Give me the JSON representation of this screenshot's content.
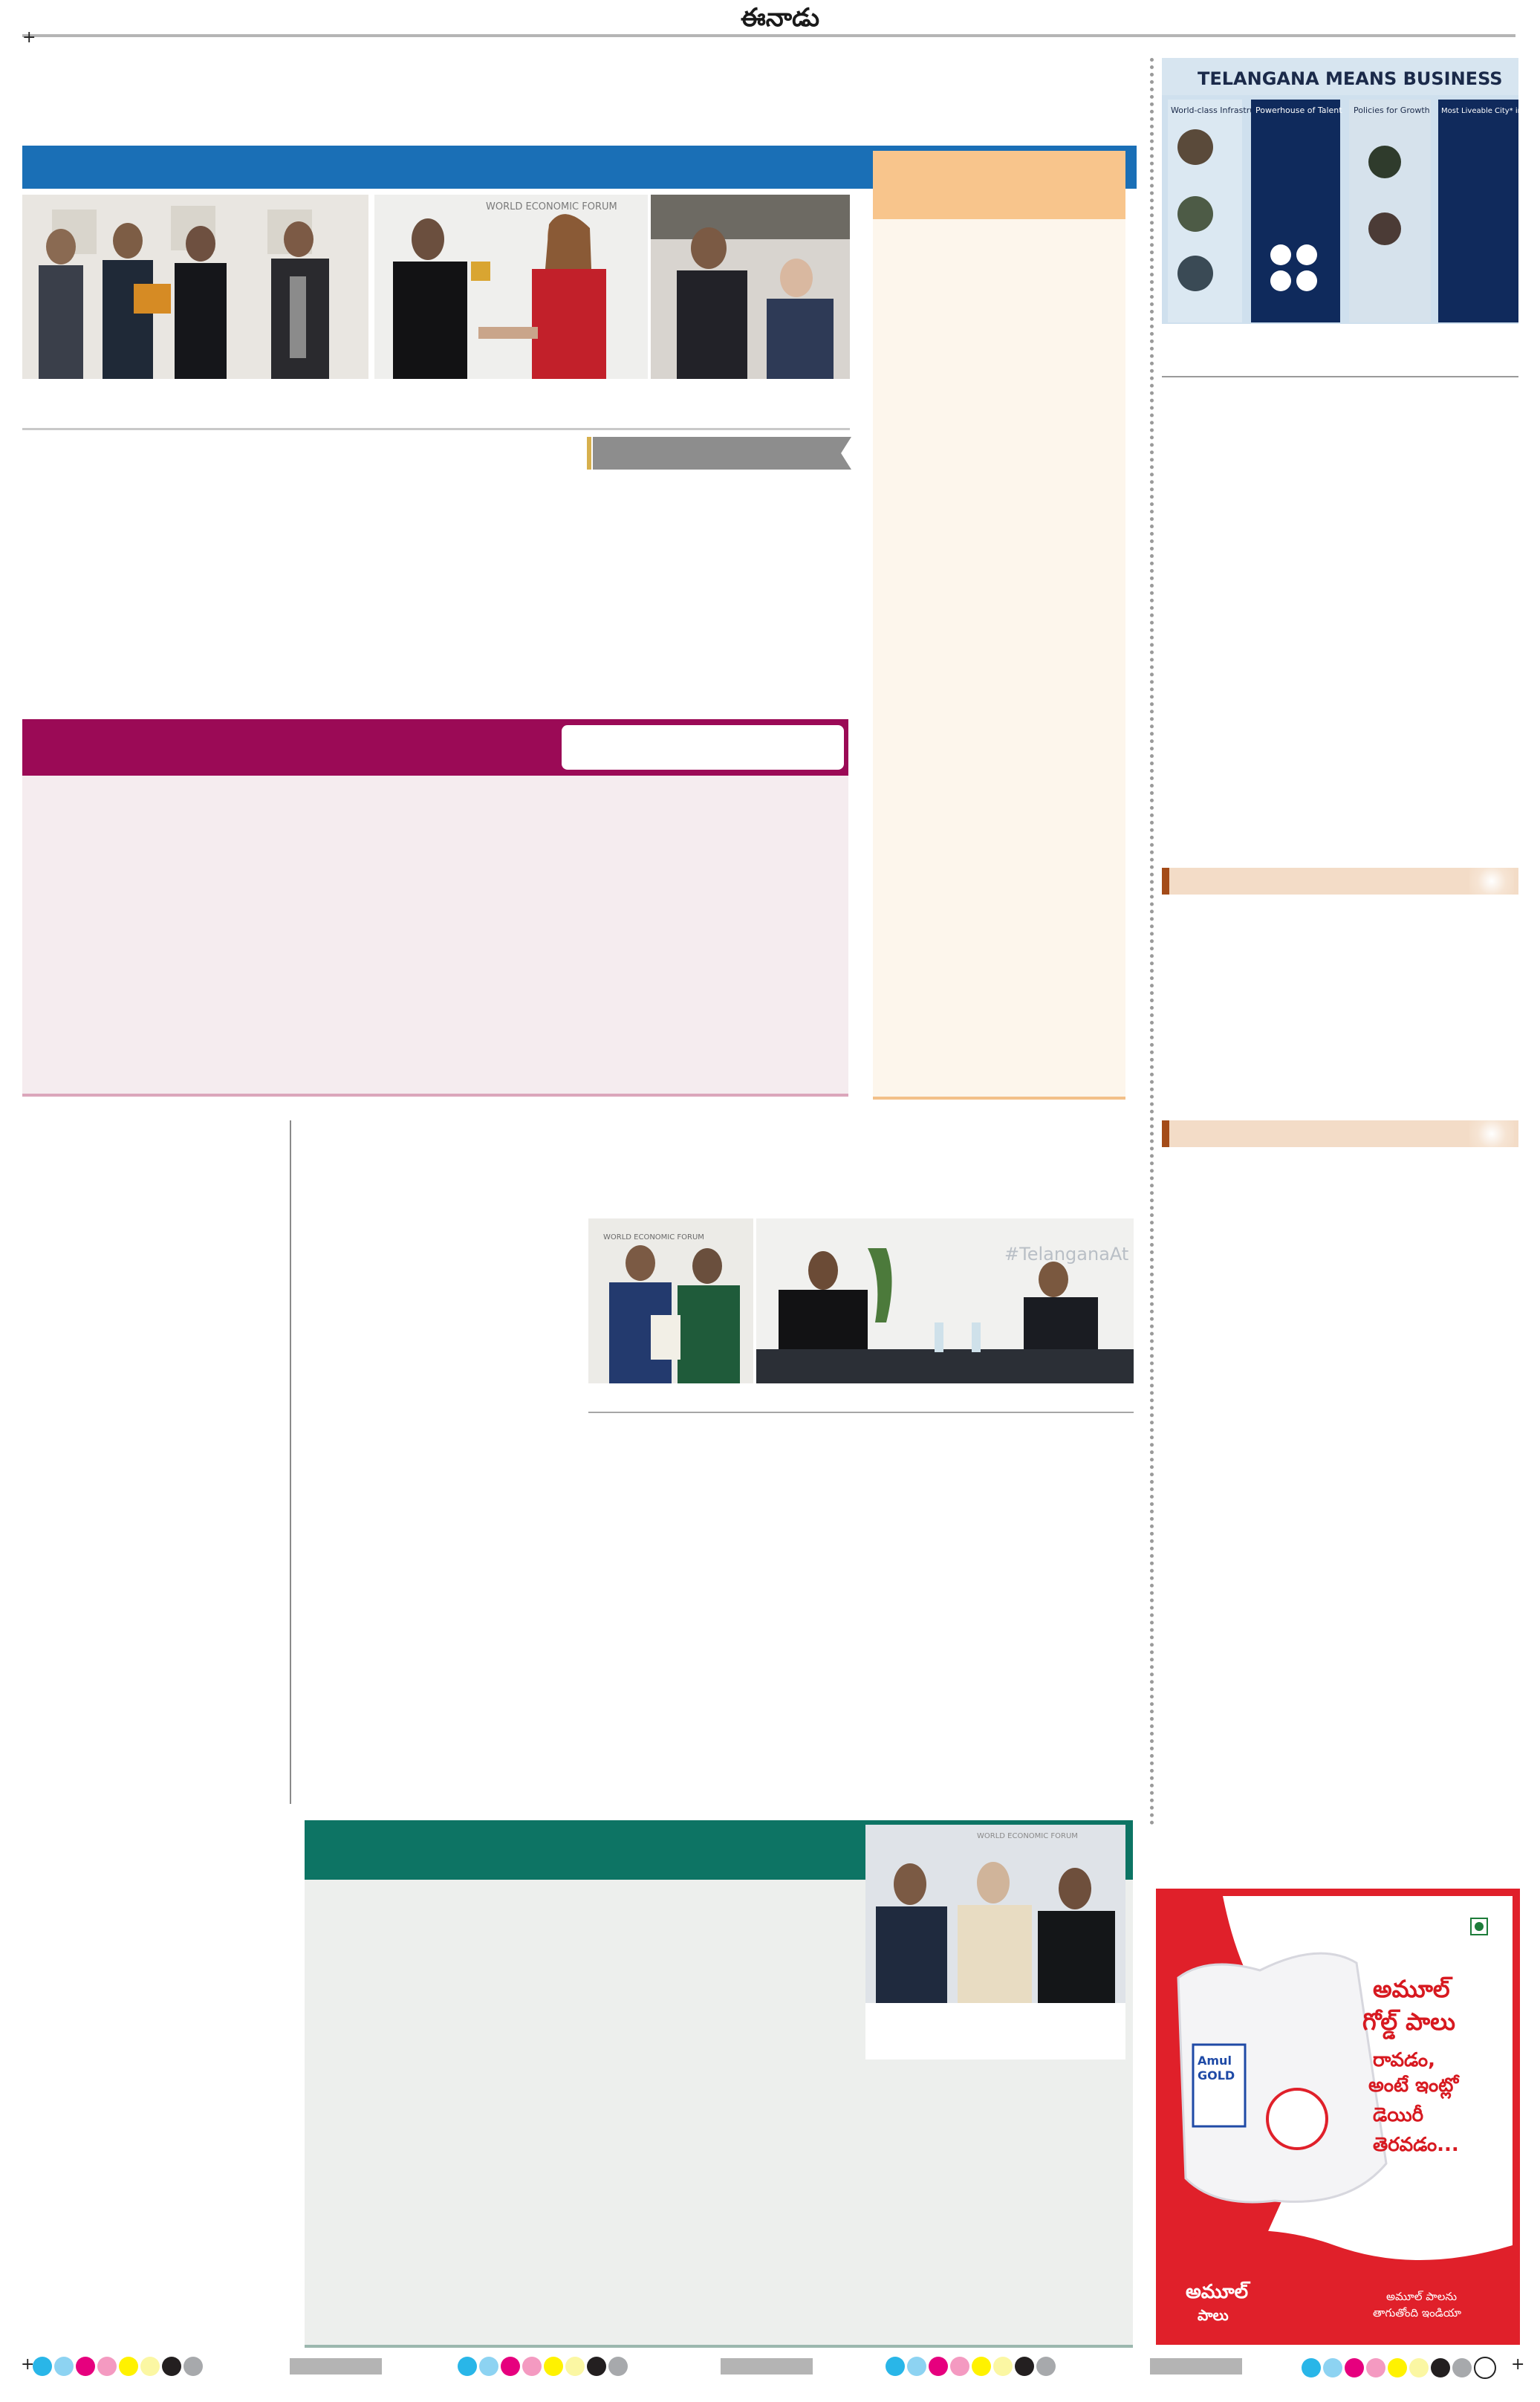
{
  "masthead": {
    "title": "ఈనాడు"
  },
  "registration_mark": "+",
  "photos": {
    "top_right_board": {
      "heading": "TELANGANA MEANS BUSINESS",
      "col1": "World-class Infrastructure",
      "col2": "Powerhouse of Talent",
      "col3": "Policies for Growth",
      "col4": "Most Liveable City* in India"
    },
    "p1_label": "WORLD ECONOMIC FORUM",
    "p2_label": "WORLD ECONOMIC FORUM",
    "meeting_hashtag": "#TelanganaAt",
    "group_label": "WORLD ECONOMIC FORUM"
  },
  "advert": {
    "line1": "అమూల్",
    "line2": "గోల్డ్ పాలు",
    "line3": "రావడం,",
    "line4": "అంటే ఇంట్లో",
    "line5": "డెయిరీ",
    "line6": "తెరవడం...",
    "pack_brand": "Amul",
    "pack_product": "GOLD",
    "brand_bottom_1": "అమూల్",
    "brand_bottom_2": "పాలు",
    "tagline_1": "అమూల్ పాలను",
    "tagline_2": "తాగుతోంది ఇండియా",
    "colors": {
      "ad_red": "#e0202a",
      "ad_blue": "#1f4aa6"
    }
  },
  "colors": {
    "blue_band": "#1a6fb6",
    "peach": "#f8c58c",
    "maroon": "#9b0a56",
    "pink_bg": "#f5ecef",
    "green_band": "#0d7464",
    "green_bg": "#edefed"
  },
  "color_bar": {
    "dots": [
      "#29b6e8",
      "#8dd3f2",
      "#e6007e",
      "#f49ac1",
      "#fff200",
      "#fbf7a3",
      "#231f20",
      "#a7a9ac"
    ]
  }
}
